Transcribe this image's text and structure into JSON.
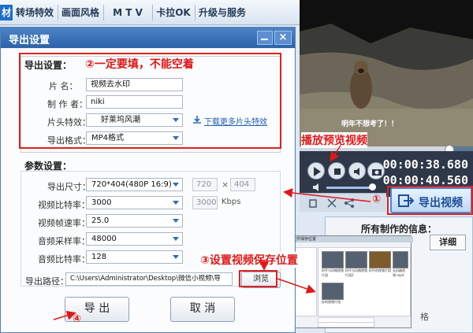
{
  "app": {
    "tabs": [
      "材",
      "转场特效",
      "画面风格",
      "M T V",
      "卡拉OK",
      "升级与服务"
    ],
    "video": {
      "subtitle": "明年不想考了！！"
    },
    "time_current": "00:00:38.680",
    "time_total": "00:00:40.560",
    "export_button": "导出视频",
    "info_panel": {
      "title": "所有制作的信息：",
      "detail_button": "详细",
      "bottom_text": "格"
    }
  },
  "dialog": {
    "title": "导出设置",
    "close_symbol": "×",
    "export_settings": {
      "section_title": "导出设置：",
      "name_label": "片   名：",
      "name_value": "视频去水印",
      "author_label": "制 作 者：",
      "author_value": "niki",
      "intro_label": "片头特效：",
      "intro_value": "好莱坞风潮",
      "download_link": "下载更多片头特效",
      "format_label": "导出格式：",
      "format_value": "MP4格式"
    },
    "params": {
      "section_title": "参数设置：",
      "size_label": "导出尺寸：",
      "size_value": "720*404(480P 16:9)",
      "width": "720",
      "times_symbol": "×",
      "height": "404",
      "video_bitrate_label": "视频比特率：",
      "video_bitrate_value": "3000",
      "video_bitrate_custom": "3000",
      "kbps": "Kbps",
      "framerate_label": "视频帧速率：",
      "framerate_value": "25.0",
      "samplerate_label": "音频采样率：",
      "samplerate_value": "48000",
      "audio_bitrate_label": "音频比特率：",
      "audio_bitrate_value": "128"
    },
    "path_label": "导出路径：",
    "path_value": "C:\\Users\\Administrator\\Desktop\\微信小视频\\导",
    "browse_button": "浏览",
    "export_button": "导 出",
    "cancel_button": "取 消"
  },
  "save_dialog": {
    "title": "浏览文件保存位置",
    "files": [
      "好坏与风格视频片段",
      "好坏与风格视频片段2",
      "好坏的视频片段",
      "无机器视频.mp4",
      "好的视频片段"
    ]
  },
  "annotations": {
    "a1": "①",
    "a2": "②一定要填，不能空着",
    "a3": "③设置视频保存位置",
    "a4": "④",
    "preview_label": "播放预览视频"
  },
  "colors": {
    "accent": "#2c62a8",
    "annotation": "#e01818"
  }
}
